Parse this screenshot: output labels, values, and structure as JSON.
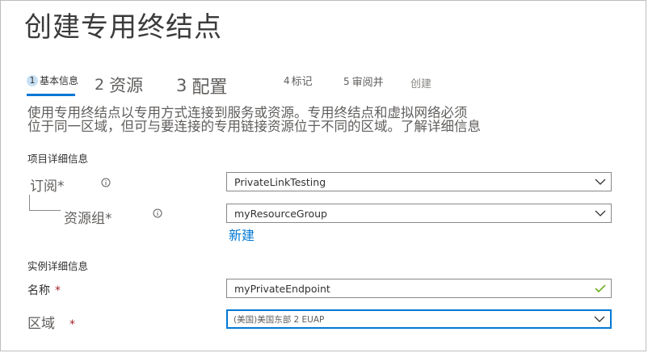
{
  "page": {
    "title": "创建专用终结点"
  },
  "steps": [
    {
      "num": "1",
      "label": "基本信息"
    },
    {
      "num": "2",
      "label": "资源"
    },
    {
      "num": "3",
      "label": "配置"
    },
    {
      "num": "4",
      "label": "标记"
    },
    {
      "num": "5",
      "label": "审阅并"
    },
    {
      "num": "",
      "label": "创建"
    }
  ],
  "description": {
    "line1": "使用专用终结点以专用方式连接到服务或资源。专用终结点和虚拟网络必须",
    "line2": "位于同一区域，但可与要连接的专用链接资源位于不同的区域。了解详细信息"
  },
  "project_details": {
    "heading": "项目详细信息",
    "subscription": {
      "label": "订阅*",
      "value": "PrivateLinkTesting"
    },
    "resource_group": {
      "label": "资源组*",
      "value": "myResourceGroup",
      "create_new": "新建"
    }
  },
  "instance_details": {
    "heading": "实例详细信息",
    "name": {
      "label": "名称",
      "required": "*",
      "value": "myPrivateEndpoint"
    },
    "region": {
      "label": "区域",
      "required": "*",
      "value": "(美国)美国东部 2 EUAP"
    }
  },
  "colors": {
    "accent": "#0078d4",
    "required": "#a4262c",
    "valid": "#57a300"
  },
  "icons": [
    "info-icon",
    "chevron-down-icon",
    "checkmark-icon"
  ]
}
